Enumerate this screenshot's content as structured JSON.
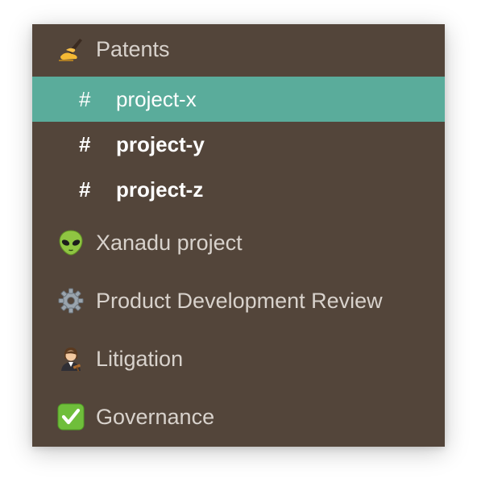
{
  "sidebar": {
    "sections": [
      {
        "label": "Patents",
        "icon": "writing-hand-icon"
      },
      {
        "label": "Xanadu project",
        "icon": "alien-icon"
      },
      {
        "label": "Product Development Review",
        "icon": "gear-icon"
      },
      {
        "label": "Litigation",
        "icon": "judge-icon"
      },
      {
        "label": "Governance",
        "icon": "check-mark-button-icon"
      }
    ],
    "channels": [
      {
        "hash": "#",
        "label": "project-x",
        "state": "selected"
      },
      {
        "hash": "#",
        "label": "project-y",
        "state": "unread"
      },
      {
        "hash": "#",
        "label": "project-z",
        "state": "unread"
      }
    ]
  },
  "colors": {
    "background": "#53453a",
    "selected": "#5aac9b",
    "text": "#d8d2cc",
    "active_text": "#ffffff"
  }
}
